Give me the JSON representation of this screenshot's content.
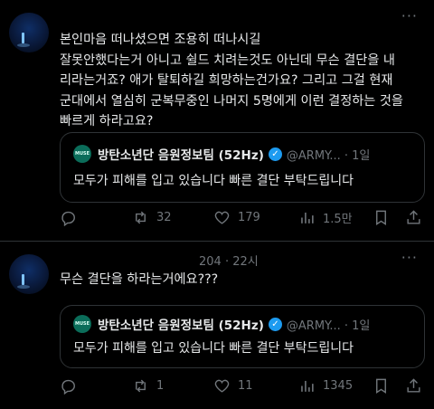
{
  "posts": [
    {
      "header": "",
      "more": "···",
      "lines": [
        "본인마음 떠나셨으면 조용히 떠나시길",
        "잘못안했다는거 아니고 쉴드 치려는것도 아닌데 무슨 결단을 내",
        "리라는거죠? 애가 탈퇴하길 희망하는건가요? 그리고 그걸 현재",
        "군대에서 열심히 군복무중인 나머지 5명에게 이런 결정하는 것을",
        "빠르게 하라고요?"
      ],
      "quote": {
        "avatar_label": "MUSE",
        "name": "방탄소년단 음원정보팀 (52Hz)",
        "handle": "@ARMY... · 1일",
        "text": "모두가 피해를 입고 있습니다 빠른 결단 부탁드립니다"
      },
      "stats": {
        "replies": "",
        "reposts": "32",
        "likes": "179",
        "views": "1.5만"
      }
    },
    {
      "header": "204 · 22시",
      "more": "···",
      "lines": [
        "무슨 결단을 하라는거에요???"
      ],
      "quote": {
        "avatar_label": "MUSE",
        "name": "방탄소년단 음원정보팀 (52Hz)",
        "handle": "@ARMY... · 1일",
        "text": "모두가 피해를 입고 있습니다 빠른 결단 부탁드립니다"
      },
      "stats": {
        "replies": "",
        "reposts": "1",
        "likes": "11",
        "views": "1345"
      }
    }
  ],
  "colors": {
    "background": "#000000",
    "text": "#e7e9ea",
    "muted": "#71767b",
    "verified": "#1d9bf0",
    "border": "#2f3336"
  }
}
